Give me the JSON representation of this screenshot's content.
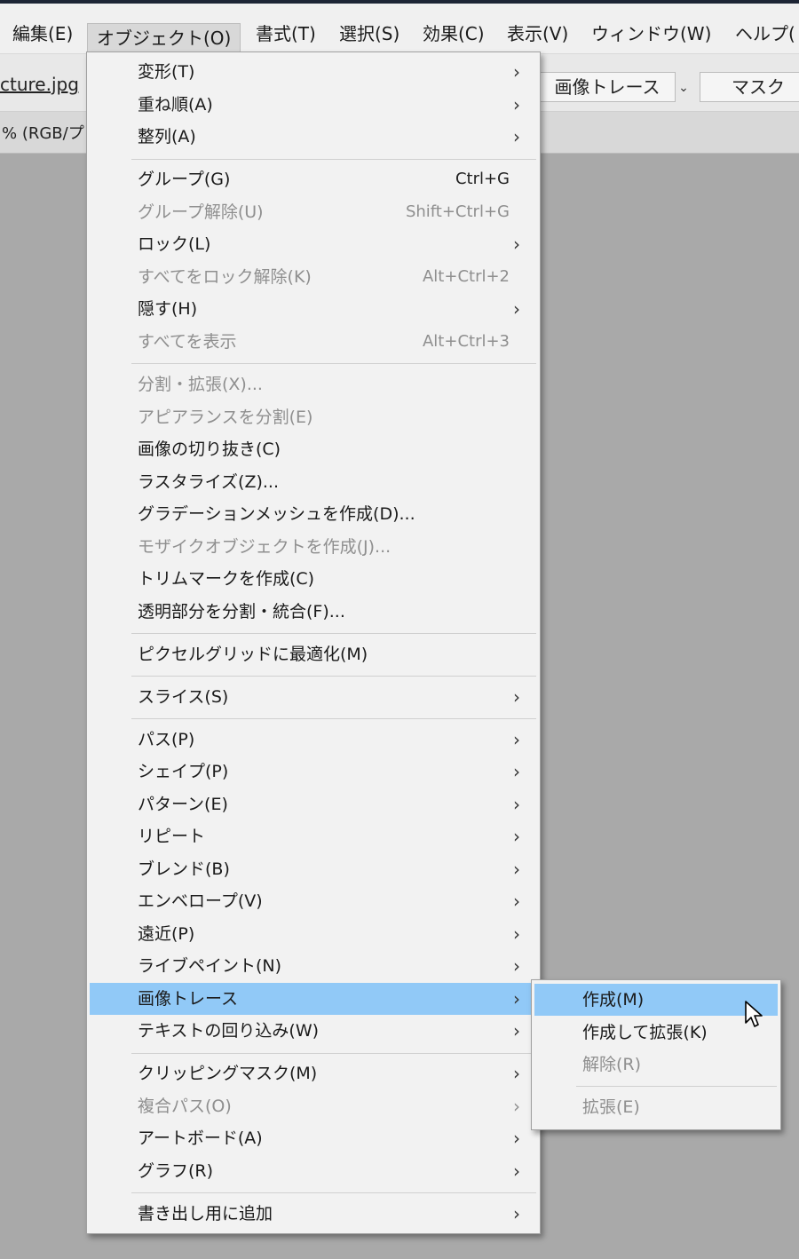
{
  "menubar": {
    "items": [
      "編集(E)",
      "オブジェクト(O)",
      "書式(T)",
      "選択(S)",
      "効果(C)",
      "表示(V)",
      "ウィンドウ(W)",
      "ヘルプ("
    ]
  },
  "controlbar": {
    "filename": "cture.jpg",
    "image_trace_button": "画像トレース",
    "mask_button": "マスク"
  },
  "tab": {
    "label": "% (RGB/プ"
  },
  "object_menu": {
    "items": [
      {
        "label": "変形(T)",
        "shortcut": "",
        "submenu": true,
        "enabled": true
      },
      {
        "label": "重ね順(A)",
        "shortcut": "",
        "submenu": true,
        "enabled": true
      },
      {
        "label": "整列(A)",
        "shortcut": "",
        "submenu": true,
        "enabled": true
      },
      {
        "label": "グループ(G)",
        "shortcut": "Ctrl+G",
        "submenu": false,
        "enabled": true
      },
      {
        "label": "グループ解除(U)",
        "shortcut": "Shift+Ctrl+G",
        "submenu": false,
        "enabled": false
      },
      {
        "label": "ロック(L)",
        "shortcut": "",
        "submenu": true,
        "enabled": true
      },
      {
        "label": "すべてをロック解除(K)",
        "shortcut": "Alt+Ctrl+2",
        "submenu": false,
        "enabled": false
      },
      {
        "label": "隠す(H)",
        "shortcut": "",
        "submenu": true,
        "enabled": true
      },
      {
        "label": "すべてを表示",
        "shortcut": "Alt+Ctrl+3",
        "submenu": false,
        "enabled": false
      },
      {
        "label": "分割・拡張(X)...",
        "shortcut": "",
        "submenu": false,
        "enabled": false
      },
      {
        "label": "アピアランスを分割(E)",
        "shortcut": "",
        "submenu": false,
        "enabled": false
      },
      {
        "label": "画像の切り抜き(C)",
        "shortcut": "",
        "submenu": false,
        "enabled": true
      },
      {
        "label": "ラスタライズ(Z)...",
        "shortcut": "",
        "submenu": false,
        "enabled": true
      },
      {
        "label": "グラデーションメッシュを作成(D)...",
        "shortcut": "",
        "submenu": false,
        "enabled": true
      },
      {
        "label": "モザイクオブジェクトを作成(J)...",
        "shortcut": "",
        "submenu": false,
        "enabled": false
      },
      {
        "label": "トリムマークを作成(C)",
        "shortcut": "",
        "submenu": false,
        "enabled": true
      },
      {
        "label": "透明部分を分割・統合(F)...",
        "shortcut": "",
        "submenu": false,
        "enabled": true
      },
      {
        "label": "ピクセルグリッドに最適化(M)",
        "shortcut": "",
        "submenu": false,
        "enabled": true
      },
      {
        "label": "スライス(S)",
        "shortcut": "",
        "submenu": true,
        "enabled": true
      },
      {
        "label": "パス(P)",
        "shortcut": "",
        "submenu": true,
        "enabled": true
      },
      {
        "label": "シェイプ(P)",
        "shortcut": "",
        "submenu": true,
        "enabled": true
      },
      {
        "label": "パターン(E)",
        "shortcut": "",
        "submenu": true,
        "enabled": true
      },
      {
        "label": "リピート",
        "shortcut": "",
        "submenu": true,
        "enabled": true
      },
      {
        "label": "ブレンド(B)",
        "shortcut": "",
        "submenu": true,
        "enabled": true
      },
      {
        "label": "エンベロープ(V)",
        "shortcut": "",
        "submenu": true,
        "enabled": true
      },
      {
        "label": "遠近(P)",
        "shortcut": "",
        "submenu": true,
        "enabled": true
      },
      {
        "label": "ライブペイント(N)",
        "shortcut": "",
        "submenu": true,
        "enabled": true
      },
      {
        "label": "画像トレース",
        "shortcut": "",
        "submenu": true,
        "enabled": true,
        "highlighted": true
      },
      {
        "label": "テキストの回り込み(W)",
        "shortcut": "",
        "submenu": true,
        "enabled": true
      },
      {
        "label": "クリッピングマスク(M)",
        "shortcut": "",
        "submenu": true,
        "enabled": true
      },
      {
        "label": "複合パス(O)",
        "shortcut": "",
        "submenu": true,
        "enabled": false
      },
      {
        "label": "アートボード(A)",
        "shortcut": "",
        "submenu": true,
        "enabled": true
      },
      {
        "label": "グラフ(R)",
        "shortcut": "",
        "submenu": true,
        "enabled": true
      },
      {
        "label": "書き出し用に追加",
        "shortcut": "",
        "submenu": true,
        "enabled": true
      }
    ]
  },
  "image_trace_submenu": {
    "items": [
      {
        "label": "作成(M)",
        "enabled": true,
        "highlighted": true
      },
      {
        "label": "作成して拡張(K)",
        "enabled": true
      },
      {
        "label": "解除(R)",
        "enabled": false
      },
      {
        "label": "拡張(E)",
        "enabled": false
      }
    ]
  },
  "icons": {
    "submenu_arrow": "chevron-right-icon",
    "dropdown": "chevron-down-icon",
    "cursor": "mouse-pointer-icon"
  },
  "colors": {
    "highlight": "#91c9f7",
    "disabled_text": "#8f8f8f",
    "menu_bg": "#f2f2f2",
    "canvas_bg": "#a9a9a9"
  }
}
